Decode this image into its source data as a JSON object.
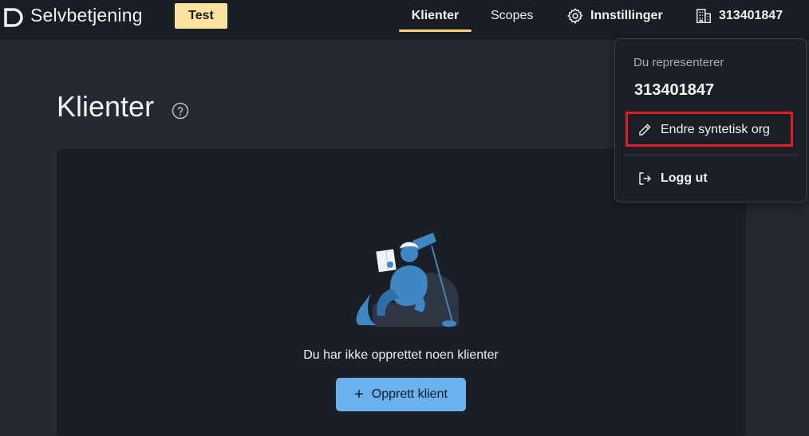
{
  "header": {
    "brand": "Selvbetjening",
    "env_badge": "Test",
    "nav": [
      {
        "label": "Klienter",
        "active": true
      },
      {
        "label": "Scopes",
        "active": false
      },
      {
        "label": "Innstillinger",
        "icon": "gear-icon"
      },
      {
        "label": "313401847",
        "icon": "building-icon"
      }
    ]
  },
  "main": {
    "title": "Klienter",
    "help_icon": "help-circle-icon",
    "empty_message": "Du har ikke opprettet noen klienter",
    "create_button": "Opprett klient",
    "create_icon": "plus-icon"
  },
  "dropdown": {
    "label": "Du representerer",
    "org": "313401847",
    "items": [
      {
        "label": "Endre syntetisk org",
        "icon": "pencil-icon"
      },
      {
        "label": "Logg ut",
        "icon": "logout-icon"
      }
    ]
  },
  "colors": {
    "background": "#242932",
    "topbar": "#191d24",
    "card": "#1a1e25",
    "badge": "#fbe29f",
    "accent_underline": "#f4d37c",
    "primary_button": "#69b2ee",
    "highlight": "#e01e25"
  }
}
